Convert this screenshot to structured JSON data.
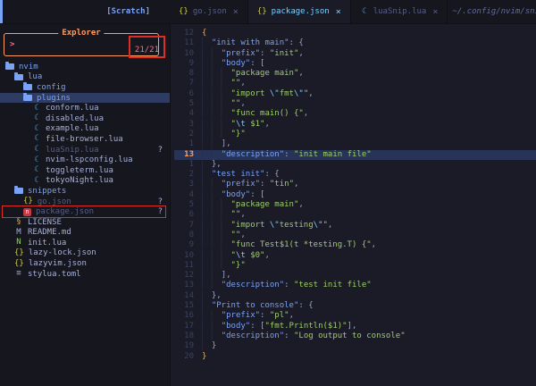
{
  "topbar": {
    "scratch_label": "[Scratch]",
    "session_path": "~/.config/nvim/sni",
    "tabs": [
      {
        "icon": "json-icon",
        "label": "go.json",
        "close": "×",
        "active": false
      },
      {
        "icon": "json-icon",
        "label": "package.json",
        "close": "×",
        "active": true
      },
      {
        "icon": "lua-icon",
        "label": "luaSnip.lua",
        "close": "×",
        "active": false
      }
    ]
  },
  "explorer": {
    "title": "Explorer",
    "prompt": ">",
    "count": "21/21",
    "items": [
      {
        "label": "nvim",
        "icon": "folder-open-icon",
        "indent": 0,
        "kind": "folder"
      },
      {
        "label": "lua",
        "icon": "folder-open-icon",
        "indent": 1,
        "kind": "folder"
      },
      {
        "label": "config",
        "icon": "folder-closed-icon",
        "indent": 2,
        "kind": "folder"
      },
      {
        "label": "plugins",
        "icon": "folder-open-icon",
        "indent": 2,
        "kind": "folder",
        "selected": true
      },
      {
        "label": "conform.lua",
        "icon": "lua-icon",
        "indent": 3
      },
      {
        "label": "disabled.lua",
        "icon": "lua-icon",
        "indent": 3
      },
      {
        "label": "example.lua",
        "icon": "lua-icon",
        "indent": 3
      },
      {
        "label": "file-browser.lua",
        "icon": "lua-icon",
        "indent": 3
      },
      {
        "label": "luaSnip.lua",
        "icon": "lua-icon",
        "indent": 3,
        "dim": true,
        "git": "?"
      },
      {
        "label": "nvim-lspconfig.lua",
        "icon": "lua-icon",
        "indent": 3
      },
      {
        "label": "toggleterm.lua",
        "icon": "lua-icon",
        "indent": 3
      },
      {
        "label": "tokyoNight.lua",
        "icon": "lua-icon",
        "indent": 3
      },
      {
        "label": "snippets",
        "icon": "folder-open-icon",
        "indent": 1,
        "kind": "folder"
      },
      {
        "label": "go.json",
        "icon": "json-icon",
        "indent": 2,
        "dim": true,
        "git": "?"
      },
      {
        "label": "package.json",
        "icon": "npm-icon",
        "indent": 2,
        "dim": true,
        "git": "?",
        "annotated": true
      },
      {
        "label": "LICENSE",
        "icon": "license-icon",
        "indent": 1
      },
      {
        "label": "README.md",
        "icon": "markdown-icon",
        "indent": 1
      },
      {
        "label": "init.lua",
        "icon": "neovim-icon",
        "indent": 1
      },
      {
        "label": "lazy-lock.json",
        "icon": "json-icon",
        "indent": 1
      },
      {
        "label": "lazyvim.json",
        "icon": "json-icon",
        "indent": 1
      },
      {
        "label": "stylua.toml",
        "icon": "toml-icon",
        "indent": 1
      }
    ]
  },
  "editor": {
    "cursor_line_number": "13",
    "lines": [
      {
        "n": "12",
        "i": 0,
        "t": [
          [
            "b1",
            "{"
          ]
        ]
      },
      {
        "n": "11",
        "i": 1,
        "t": [
          [
            "k",
            "\"init with main\""
          ],
          [
            "p",
            ": {"
          ]
        ]
      },
      {
        "n": "10",
        "i": 2,
        "t": [
          [
            "k",
            "\"prefix\""
          ],
          [
            "p",
            ": "
          ],
          [
            "s",
            "\"init\""
          ],
          [
            "p",
            ","
          ]
        ]
      },
      {
        "n": "9",
        "i": 2,
        "t": [
          [
            "k",
            "\"body\""
          ],
          [
            "p",
            ": ["
          ]
        ]
      },
      {
        "n": "8",
        "i": 3,
        "t": [
          [
            "s",
            "\"package main\""
          ],
          [
            "p",
            ","
          ]
        ]
      },
      {
        "n": "7",
        "i": 3,
        "t": [
          [
            "s",
            "\"\""
          ],
          [
            "p",
            ","
          ]
        ]
      },
      {
        "n": "6",
        "i": 3,
        "t": [
          [
            "s",
            "\"import "
          ],
          [
            "e",
            "\\\""
          ],
          [
            "s",
            "fmt"
          ],
          [
            "e",
            "\\\""
          ],
          [
            "s",
            "\""
          ],
          [
            "p",
            ","
          ]
        ]
      },
      {
        "n": "5",
        "i": 3,
        "t": [
          [
            "s",
            "\"\""
          ],
          [
            "p",
            ","
          ]
        ]
      },
      {
        "n": "4",
        "i": 3,
        "t": [
          [
            "s",
            "\"func main() {\""
          ],
          [
            "p",
            ","
          ]
        ]
      },
      {
        "n": "3",
        "i": 3,
        "t": [
          [
            "s",
            "\""
          ],
          [
            "e",
            "\\t"
          ],
          [
            "s",
            " $1\""
          ],
          [
            "p",
            ","
          ]
        ]
      },
      {
        "n": "2",
        "i": 3,
        "t": [
          [
            "s",
            "\"}\""
          ]
        ]
      },
      {
        "n": "1",
        "i": 2,
        "t": [
          [
            "p",
            "],"
          ]
        ]
      },
      {
        "n": "13",
        "i": 2,
        "c": true,
        "t": [
          [
            "k",
            "\"description\""
          ],
          [
            "p",
            ": "
          ],
          [
            "s",
            "\"init main file\""
          ]
        ]
      },
      {
        "n": "1",
        "i": 1,
        "t": [
          [
            "p",
            "},"
          ]
        ]
      },
      {
        "n": "2",
        "i": 1,
        "t": [
          [
            "k",
            "\"test init\""
          ],
          [
            "p",
            ": {"
          ]
        ]
      },
      {
        "n": "3",
        "i": 2,
        "t": [
          [
            "k",
            "\"prefix\""
          ],
          [
            "p",
            ": "
          ],
          [
            "s",
            "\"tin\""
          ],
          [
            "p",
            ","
          ]
        ]
      },
      {
        "n": "4",
        "i": 2,
        "t": [
          [
            "k",
            "\"body\""
          ],
          [
            "p",
            ": ["
          ]
        ]
      },
      {
        "n": "5",
        "i": 3,
        "t": [
          [
            "s",
            "\"package main\""
          ],
          [
            "p",
            ","
          ]
        ]
      },
      {
        "n": "6",
        "i": 3,
        "t": [
          [
            "s",
            "\"\""
          ],
          [
            "p",
            ","
          ]
        ]
      },
      {
        "n": "7",
        "i": 3,
        "t": [
          [
            "s",
            "\"import "
          ],
          [
            "e",
            "\\\""
          ],
          [
            "s",
            "testing"
          ],
          [
            "e",
            "\\\""
          ],
          [
            "s",
            "\""
          ],
          [
            "p",
            ","
          ]
        ]
      },
      {
        "n": "8",
        "i": 3,
        "t": [
          [
            "s",
            "\"\""
          ],
          [
            "p",
            ","
          ]
        ]
      },
      {
        "n": "9",
        "i": 3,
        "t": [
          [
            "s",
            "\"func Test$1(t *testing.T) {\""
          ],
          [
            "p",
            ","
          ]
        ]
      },
      {
        "n": "10",
        "i": 3,
        "t": [
          [
            "s",
            "\""
          ],
          [
            "e",
            "\\t"
          ],
          [
            "s",
            " $0\""
          ],
          [
            "p",
            ","
          ]
        ]
      },
      {
        "n": "11",
        "i": 3,
        "t": [
          [
            "s",
            "\"}\""
          ]
        ]
      },
      {
        "n": "12",
        "i": 2,
        "t": [
          [
            "p",
            "],"
          ]
        ]
      },
      {
        "n": "13",
        "i": 2,
        "t": [
          [
            "k",
            "\"description\""
          ],
          [
            "p",
            ": "
          ],
          [
            "s",
            "\"test init file\""
          ]
        ]
      },
      {
        "n": "14",
        "i": 1,
        "t": [
          [
            "p",
            "},"
          ]
        ]
      },
      {
        "n": "15",
        "i": 1,
        "t": [
          [
            "k",
            "\"Print to console\""
          ],
          [
            "p",
            ": {"
          ]
        ]
      },
      {
        "n": "16",
        "i": 2,
        "t": [
          [
            "k",
            "\"prefix\""
          ],
          [
            "p",
            ": "
          ],
          [
            "s",
            "\"pl\""
          ],
          [
            "p",
            ","
          ]
        ]
      },
      {
        "n": "17",
        "i": 2,
        "t": [
          [
            "k",
            "\"body\""
          ],
          [
            "p",
            ": ["
          ],
          [
            "s",
            "\"fmt.Println($1)\""
          ],
          [
            "p",
            "],"
          ]
        ]
      },
      {
        "n": "18",
        "i": 2,
        "t": [
          [
            "k",
            "\"description\""
          ],
          [
            "p",
            ": "
          ],
          [
            "s",
            "\"Log output to console\""
          ]
        ]
      },
      {
        "n": "19",
        "i": 1,
        "t": [
          [
            "p",
            "}"
          ]
        ]
      },
      {
        "n": "20",
        "i": 0,
        "t": [
          [
            "b1",
            "}"
          ]
        ]
      }
    ]
  },
  "colors": {
    "background": "#1a1b26",
    "panel_background": "#16161e",
    "explorer_border_orange": "#ff9e64",
    "annotation_red": "#de2d26",
    "selection_blue": "#2e3c64",
    "active_tab_cyan": "#7dcfff",
    "json_key_blue": "#7aa2f7",
    "json_string_green": "#9ece6a",
    "escape_cyan": "#7dcfff",
    "cursor_line_number_orange": "#ff9e64",
    "prompt_red": "#f7768e"
  }
}
